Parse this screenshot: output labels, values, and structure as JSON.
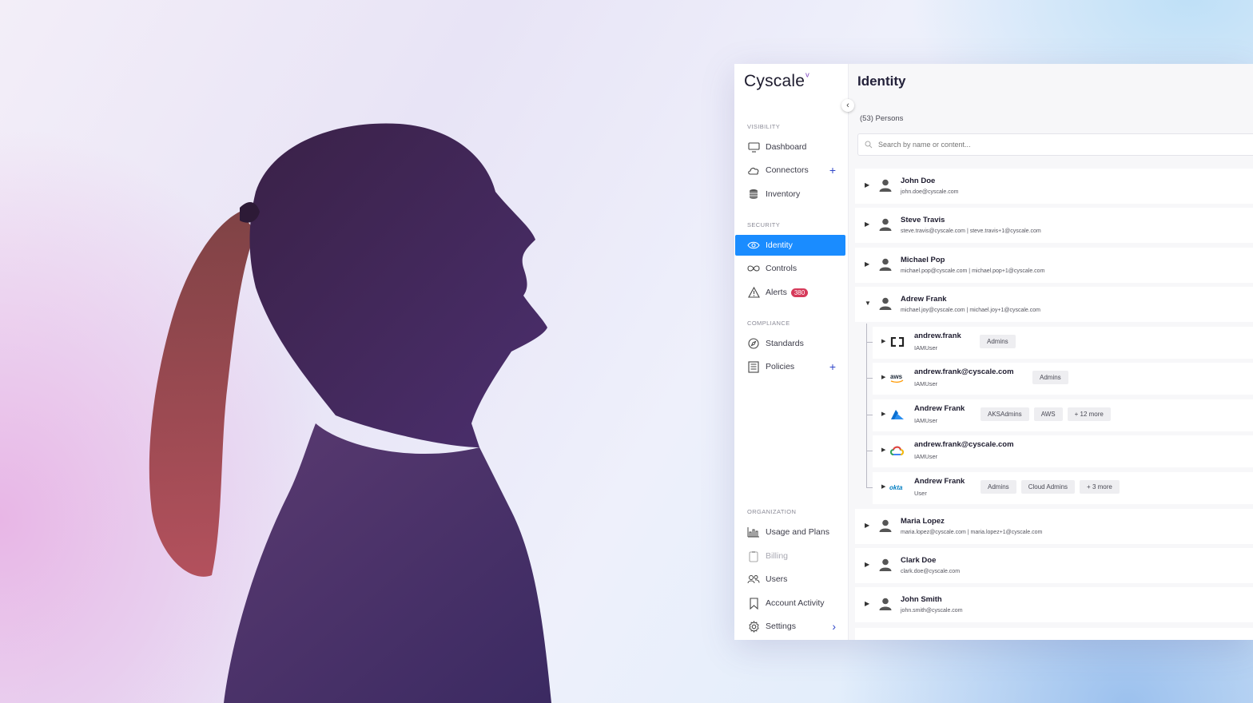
{
  "logo": {
    "text": "Cyscale",
    "mark": "ᵛ"
  },
  "sidebar": {
    "sections": {
      "visibility": "VISIBILITY",
      "security": "SECURITY",
      "compliance": "COMPLIANCE",
      "organization": "ORGANIZATION"
    },
    "items": [
      {
        "label": "Dashboard",
        "icon": "monitor-icon"
      },
      {
        "label": "Connectors",
        "icon": "cloud-icon"
      },
      {
        "label": "Inventory",
        "icon": "database-icon"
      },
      {
        "label": "Identity",
        "icon": "eye-icon",
        "active": true
      },
      {
        "label": "Controls",
        "icon": "infinity-icon"
      },
      {
        "label": "Alerts",
        "icon": "warning-icon",
        "badge": "380"
      },
      {
        "label": "Standards",
        "icon": "compass-icon"
      },
      {
        "label": "Policies",
        "icon": "document-icon"
      },
      {
        "label": "Usage and Plans",
        "icon": "bar-chart-icon"
      },
      {
        "label": "Billing",
        "icon": "clipboard-icon",
        "disabled": true
      },
      {
        "label": "Users",
        "icon": "users-icon"
      },
      {
        "label": "Account Activity",
        "icon": "bookmark-icon"
      },
      {
        "label": "Settings",
        "icon": "gear-icon"
      }
    ],
    "plus": "+",
    "chevron": "›",
    "collapse": "‹"
  },
  "main": {
    "title": "Identity",
    "count": "(53) Persons",
    "search_placeholder": "Search by name or content...",
    "persons": [
      {
        "name": "John Doe",
        "email": "john.doe@cyscale.com",
        "expanded": false
      },
      {
        "name": "Steve Travis",
        "email": "steve.travis@cyscale.com | steve.travis+1@cyscale.com",
        "expanded": false
      },
      {
        "name": "Michael Pop",
        "email": "michael.pop@cyscale.com | michael.pop+1@cyscale.com",
        "expanded": false
      },
      {
        "name": "Adrew Frank",
        "email": "michael.joy@cyscale.com | michael.joy+1@cyscale.com",
        "expanded": true
      },
      {
        "name": "Maria Lopez",
        "email": "maria.lopez@cyscale.com | maria.lopez+1@cyscale.com",
        "expanded": false
      },
      {
        "name": "Clark Doe",
        "email": "clark.doe@cyscale.com",
        "expanded": false
      },
      {
        "name": "John Smith",
        "email": "john.smith@cyscale.com",
        "expanded": false
      }
    ],
    "accounts": [
      {
        "name": "andrew.frank",
        "type": "IAMUser",
        "provider": "bracket-icon",
        "tags": [
          "Admins"
        ]
      },
      {
        "name": "andrew.frank@cyscale.com",
        "type": "IAMUser",
        "provider": "aws-icon",
        "tags": [
          "Admins"
        ]
      },
      {
        "name": "Andrew Frank",
        "type": "IAMUser",
        "provider": "azure-icon",
        "tags": [
          "AKSAdmins",
          "AWS",
          "+ 12 more"
        ]
      },
      {
        "name": "andrew.frank@cyscale.com",
        "type": "IAMUser",
        "provider": "google-cloud-icon",
        "tags": []
      },
      {
        "name": "Andrew Frank",
        "type": "User",
        "provider": "okta-icon",
        "tags": [
          "Admins",
          "Cloud Admins",
          "+ 3 more"
        ]
      }
    ],
    "provider_labels": {
      "aws": "aws",
      "okta": "okta"
    }
  },
  "colors": {
    "accent": "#1a8cff",
    "badge": "#d63a5a",
    "plus": "#3146c8"
  }
}
